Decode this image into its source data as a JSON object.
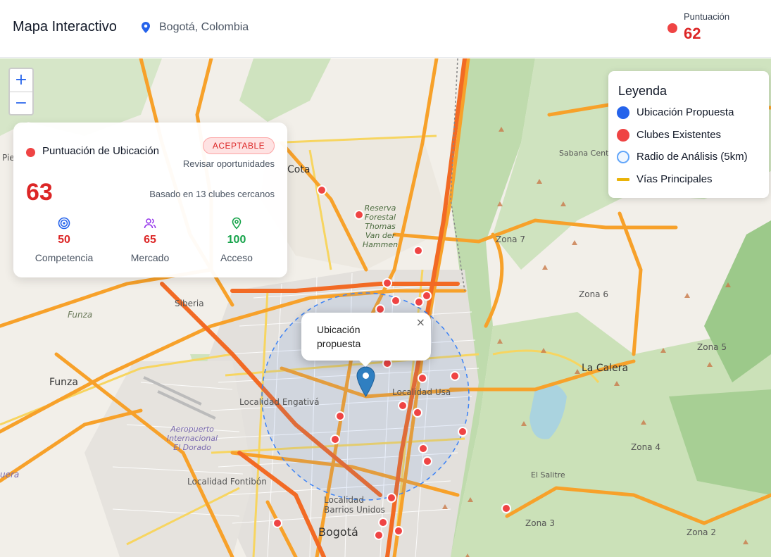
{
  "header": {
    "title": "Mapa Interactivo",
    "location_icon": "map-pin-icon",
    "location": "Bogotá, Colombia",
    "score_label": "Puntuación",
    "score_value": "62",
    "score_color": "#ef4444"
  },
  "zoom": {
    "in": "+",
    "out": "−"
  },
  "score_card": {
    "title": "Puntuación de Ubicación",
    "badge": "ACEPTABLE",
    "subtitle": "Revisar oportunidades",
    "score": "63",
    "based_on": "Basado en 13 clubes cercanos",
    "metrics": [
      {
        "icon": "target-icon",
        "value": "50",
        "label": "Competencia",
        "color": "#dc2626"
      },
      {
        "icon": "users-icon",
        "value": "65",
        "label": "Mercado",
        "color": "#dc2626"
      },
      {
        "icon": "map-pin-icon",
        "value": "100",
        "label": "Acceso",
        "color": "#16a34a"
      }
    ]
  },
  "legend": {
    "title": "Leyenda",
    "items": [
      {
        "label": "Ubicación Propuesta",
        "color": "#2563eb"
      },
      {
        "label": "Clubes Existentes",
        "color": "#ef4444"
      },
      {
        "label": "Radio de Análisis (5km)",
        "color": "#60a5fa"
      },
      {
        "label": "Vías Principales",
        "color": "#eab308"
      }
    ]
  },
  "popup": {
    "text": "Ubicación propuesta",
    "close": "×"
  },
  "map_labels": {
    "cota": "Cota",
    "siberia": "Siberia",
    "funza_small": "Funza",
    "funza": "Funza",
    "engativa": "Localidad Engativá",
    "fontibon": "Localidad Fontibón",
    "usaquen": "Localidad Usa",
    "barrios_unidos": "Localidad Barrios Unidos",
    "bogota": "Bogotá",
    "la_calera": "La Calera",
    "el_salitre": "El Salitre",
    "zona7": "Zona 7",
    "zona6": "Zona 6",
    "zona5": "Zona 5",
    "zona4": "Zona 4",
    "zona3": "Zona 3",
    "zona2": "Zona 2",
    "sabana": "Sabana Centr",
    "reserva": "Reserva Forestal Thomas Van der Hammen",
    "aeropuerto": "Aeropuerto Internacional El Dorado",
    "piedecuesta": "Pie",
    "uera": "uera"
  }
}
